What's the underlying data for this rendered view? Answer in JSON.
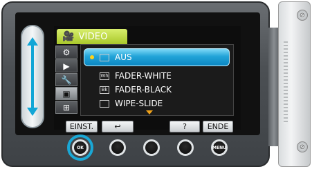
{
  "screen": {
    "tab_title": "VIDEO",
    "menu_items": [
      {
        "icon": "AUS-icon",
        "label": "AUS",
        "selected": true
      },
      {
        "icon": "Wh",
        "label": "FADER-WHITE",
        "selected": false
      },
      {
        "icon": "Bk",
        "label": "FADER-BLACK",
        "selected": false
      },
      {
        "icon": "wipe",
        "label": "WIPE-SLIDE",
        "selected": false
      }
    ]
  },
  "soft_buttons": {
    "settings_label": "EINST.",
    "back_label": "↩",
    "help_label": "?",
    "end_label": "ENDE"
  },
  "hardware": {
    "ok_label": "OK",
    "menu_label": "MENU"
  },
  "icons": {
    "wh_label": "Wh",
    "bk_label": "Bk"
  },
  "colors": {
    "accent": "#12a6d6",
    "tab_green": "#b9d83a",
    "highlight_blue": "#1a9fd6"
  }
}
